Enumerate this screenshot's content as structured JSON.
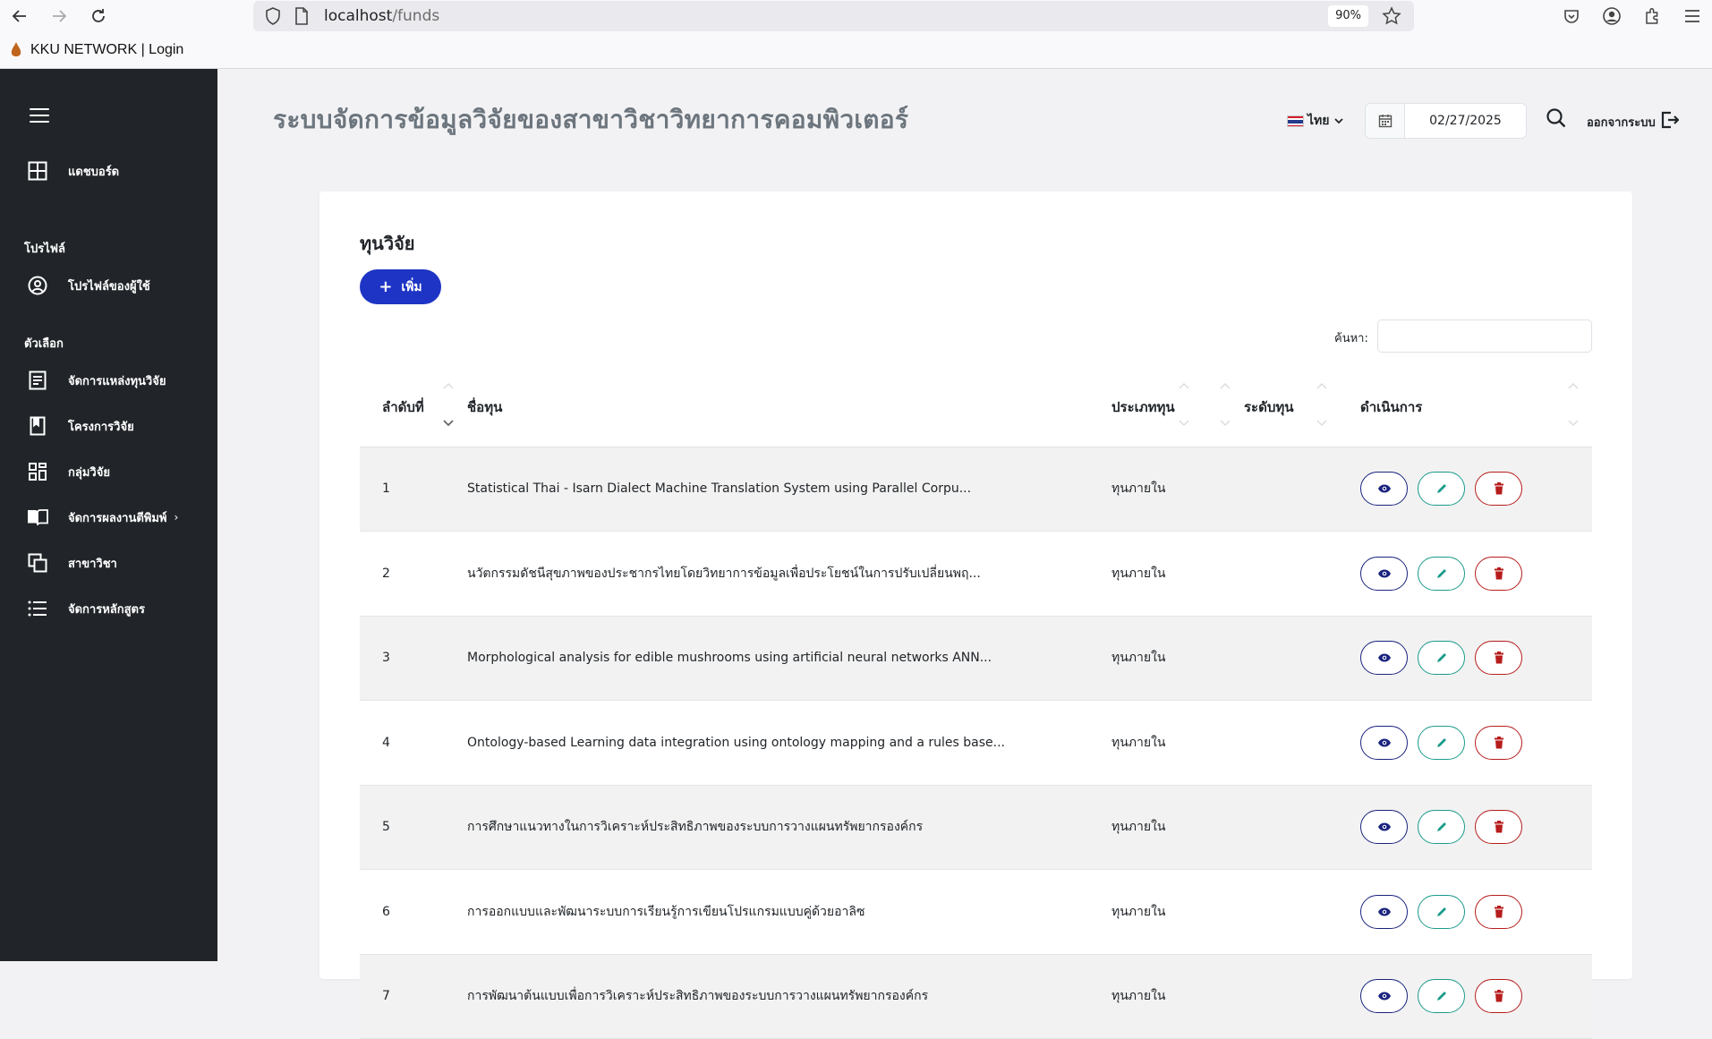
{
  "browser": {
    "url_host": "localhost",
    "url_path": "/funds",
    "zoom": "90%",
    "tab_title": "KKU NETWORK | Login"
  },
  "header": {
    "title": "ระบบจัดการข้อมูลวิจัยของสาขาวิชาวิทยาการคอมพิวเตอร์",
    "language": "ไทย",
    "date": "02/27/2025",
    "logout_label": "ออกจากระบบ"
  },
  "sidebar": {
    "dashboard": "แดชบอร์ด",
    "section_profile": "โปรไฟล์",
    "profile_item": "โปรไฟล์ของผู้ใช้",
    "section_options": "ตัวเลือก",
    "items": [
      {
        "label": "จัดการแหล่งทุนวิจัย",
        "icon": "list-document-icon"
      },
      {
        "label": "โครงการวิจัย",
        "icon": "book-icon"
      },
      {
        "label": "กลุ่มวิจัย",
        "icon": "grid-icon"
      },
      {
        "label": "จัดการผลงานตีพิมพ์",
        "icon": "open-book-icon",
        "chevron": "›"
      },
      {
        "label": "สาขาวิชา",
        "icon": "copy-icon"
      },
      {
        "label": "จัดการหลักสูตร",
        "icon": "list-icon"
      }
    ]
  },
  "card": {
    "title": "ทุนวิจัย",
    "add_label": "เพิ่ม",
    "search_label": "ค้นหา:",
    "search_value": ""
  },
  "table": {
    "columns": [
      "ลำดับที่",
      "ชื่อทุน",
      "ประเภททุน",
      "ระดับทุน",
      "ดำเนินการ"
    ],
    "rows": [
      {
        "no": "1",
        "name": "Statistical Thai - Isarn Dialect Machine Translation System using Parallel Corpu...",
        "type": "ทุนภายใน",
        "level": ""
      },
      {
        "no": "2",
        "name": "นวัตกรรมดัชนีสุขภาพของประชากรไทยโดยวิทยาการข้อมูลเพื่อประโยชน์ในการปรับเปลี่ยนพฤ...",
        "type": "ทุนภายใน",
        "level": ""
      },
      {
        "no": "3",
        "name": "Morphological analysis for edible mushrooms using artificial neural networks ANN...",
        "type": "ทุนภายใน",
        "level": ""
      },
      {
        "no": "4",
        "name": "Ontology-based Learning data integration using ontology mapping and a rules base...",
        "type": "ทุนภายใน",
        "level": ""
      },
      {
        "no": "5",
        "name": "การศึกษาแนวทางในการวิเคราะห์ประสิทธิภาพของระบบการวางแผนทรัพยากรองค์กร",
        "type": "ทุนภายใน",
        "level": ""
      },
      {
        "no": "6",
        "name": "การออกแบบและพัฒนาระบบการเรียนรู้การเขียนโปรแกรมแบบคู่ด้วยอาลิซ",
        "type": "ทุนภายใน",
        "level": ""
      },
      {
        "no": "7",
        "name": "การพัฒนาต้นแบบเพื่อการวิเคราะห์ประสิทธิภาพของระบบการวางแผนทรัพยากรองค์กร",
        "type": "ทุนภายใน",
        "level": ""
      }
    ]
  },
  "colors": {
    "sidebar_bg": "#212529",
    "primary": "#1e34c4",
    "view": "#1a237e",
    "edit": "#1a9b8a",
    "delete": "#b71c1c"
  }
}
